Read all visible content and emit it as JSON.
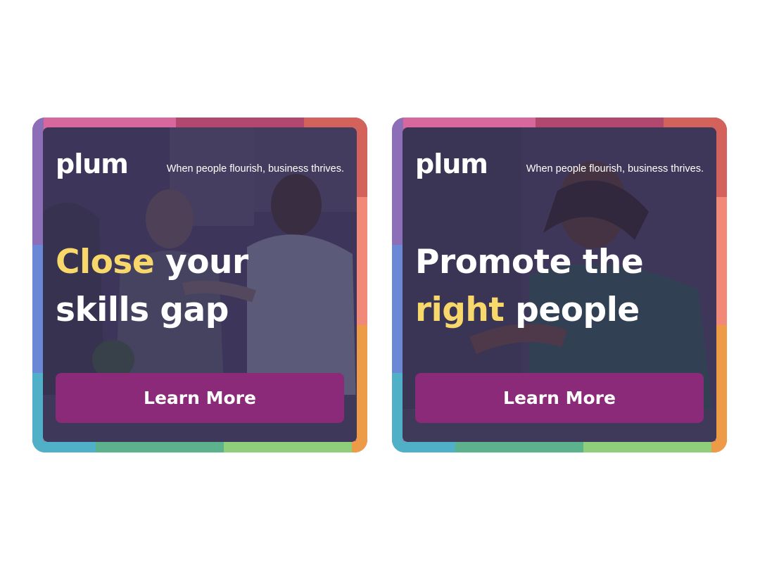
{
  "ads": [
    {
      "brand": "plum",
      "tagline": "When people flourish, business thrives.",
      "headline": {
        "line1_highlight": "Close",
        "line1_rest": " your",
        "line2": "skills gap"
      },
      "cta_label": "Learn More"
    },
    {
      "brand": "plum",
      "tagline": "When people flourish, business thrives.",
      "headline": {
        "line1": "Promote the",
        "line2_highlight": "right",
        "line2_rest": " people"
      },
      "cta_label": "Learn More"
    }
  ],
  "colors": {
    "highlight": "#f8d86a",
    "button": "#8a2a78",
    "overlay": "#3e3758"
  }
}
